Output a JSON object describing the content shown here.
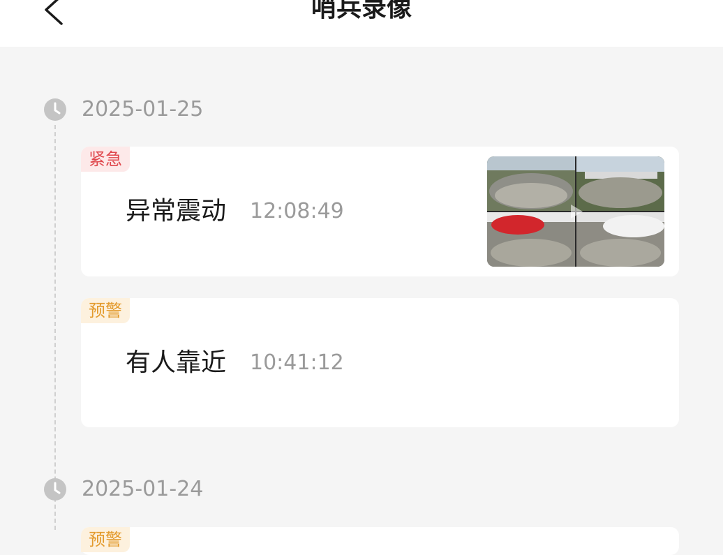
{
  "header": {
    "title": "哨兵录像",
    "back_icon": "chevron-left-icon"
  },
  "groups": [
    {
      "date": "2025-01-25",
      "events": [
        {
          "tag": "紧急",
          "tag_type": "urgent",
          "name": "异常震动",
          "time": "12:08:49",
          "has_thumbnail": true
        },
        {
          "tag": "预警",
          "tag_type": "warning",
          "name": "有人靠近",
          "time": "10:41:12",
          "has_thumbnail": false
        }
      ]
    },
    {
      "date": "2025-01-24",
      "events": [
        {
          "tag": "预警",
          "tag_type": "warning"
        }
      ]
    }
  ],
  "colors": {
    "urgent_text": "#e0494e",
    "urgent_bg": "#fde9e9",
    "warning_text": "#e39a2c",
    "warning_bg": "#fdf1de",
    "muted_text": "#9a9a9a"
  }
}
